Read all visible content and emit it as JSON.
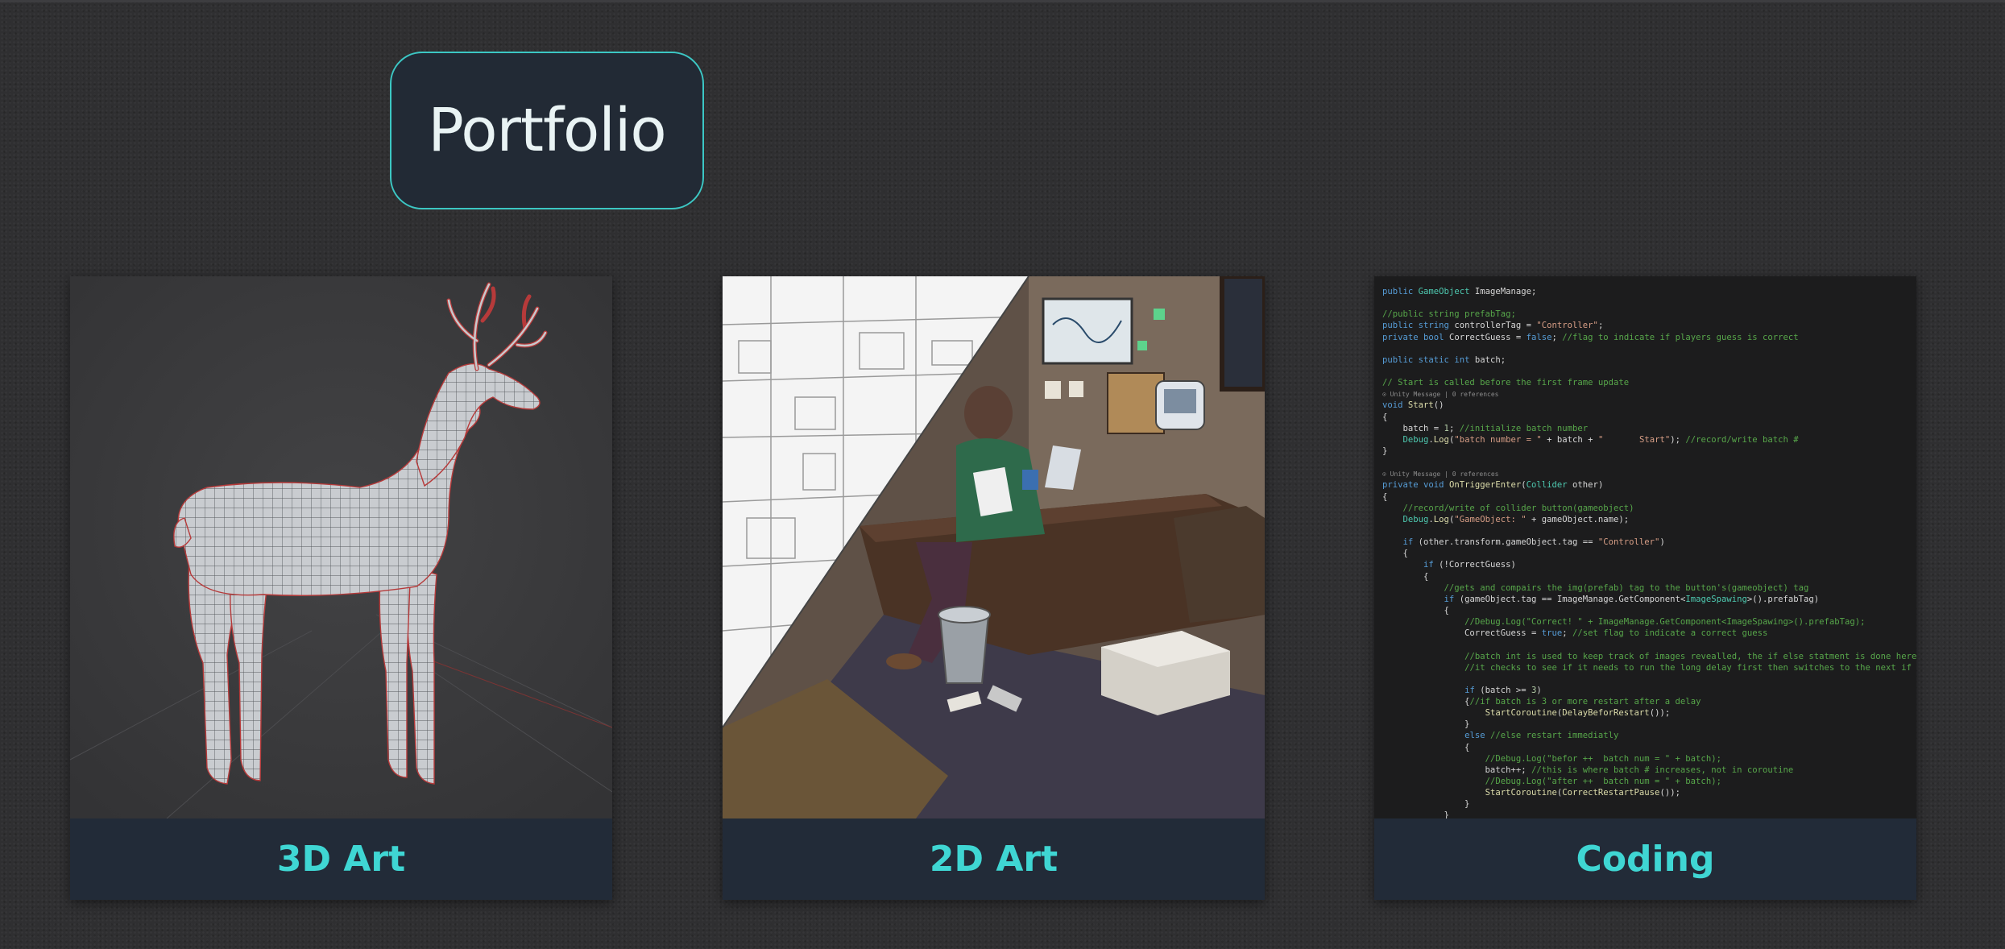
{
  "header": {
    "portfolio_label": "Portfolio"
  },
  "cards": [
    {
      "label": "3D Art",
      "thumbnail": "low-poly deer wireframe model"
    },
    {
      "label": "2D Art",
      "thumbnail": "illustrated office scene"
    },
    {
      "label": "Coding",
      "thumbnail": "C# code screenshot"
    }
  ],
  "code_lines": [
    "public GameObject ImageManage;",
    "",
    "//public string prefabTag;",
    "public string controllerTag = \"Controller\";",
    "private bool CorrectGuess = false; //flag to indicate if players guess is correct",
    "",
    "public static int batch;",
    "",
    "// Start is called before the first frame update",
    "⊙ Unity Message | 0 references",
    "void Start()",
    "{",
    "    batch = 1; //initialize batch number",
    "    Debug.Log(\"batch number = \" + batch + \"       Start\"); //record/write batch #",
    "}",
    "",
    "⊙ Unity Message | 0 references",
    "private void OnTriggerEnter(Collider other)",
    "{",
    "    //record/write of collider button(gameobject)",
    "    Debug.Log(\"GameObject: \" + gameObject.name);",
    "",
    "    if (other.transform.gameObject.tag == \"Controller\")",
    "    {",
    "        if (!CorrectGuess)",
    "        {",
    "            //gets and compairs the img(prefab) tag to the button's(gameobject) tag",
    "            if (gameObject.tag == ImageManage.GetComponent<ImageSpawing>().prefabTag)",
    "            {",
    "                //Debug.Log(\"Correct! \" + ImageManage.GetComponent<ImageSpawing>().prefabTag);",
    "                CorrectGuess = true; //set flag to indicate a correct guess",
    "",
    "                //batch int is used to keep track of images revealled, the if else statment is done here",
    "                //it checks to see if it needs to run the long delay first then switches to the next if not",
    "",
    "                if (batch >= 3)",
    "                {//if batch is 3 or more restart after a delay",
    "                    StartCoroutine(DelayBeforRestart());",
    "                }",
    "                else //else restart immediatly",
    "                {",
    "                    //Debug.Log(\"befor ++  batch num = \" + batch);",
    "                    batch++; //this is where batch # increases, not in coroutine",
    "                    //Debug.Log(\"after ++  batch num = \" + batch);",
    "                    StartCoroutine(CorrectRestartPause());",
    "                }",
    "            }"
  ]
}
